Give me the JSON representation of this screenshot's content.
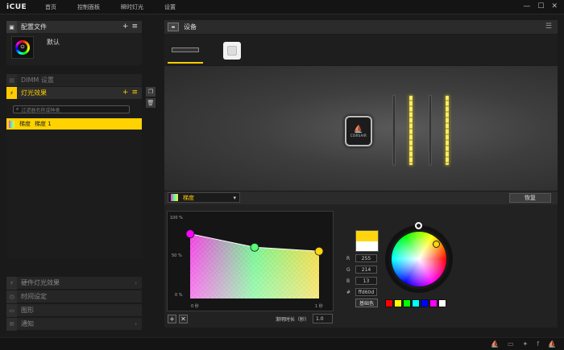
{
  "app": {
    "logo": "iCUE"
  },
  "nav": {
    "items": [
      "首页",
      "控制面板",
      "瞬时灯光",
      "设置"
    ]
  },
  "window": {
    "minimize": "—",
    "maximize": "☐",
    "close": "✕"
  },
  "profiles": {
    "title": "配置文件",
    "add": "+",
    "menu": "≡",
    "current": "默认"
  },
  "dimm": {
    "title": "DIMM 设置"
  },
  "lighting": {
    "title": "灯光效果",
    "add": "+",
    "menu": "≡",
    "filter_placeholder": "过滤器名称或种类",
    "effect_type": "梯度",
    "effect_name": "梯度 1"
  },
  "lower_nav": {
    "hardware": "硬件灯光效果",
    "time": "时间设定",
    "graphics": "图形",
    "notify": "通知"
  },
  "devices": {
    "title": "设备",
    "pump_brand": "CORSAIR"
  },
  "editor": {
    "effect_select": "梯度",
    "restore": "恢复",
    "y_labels": [
      "100 %",
      "50 %",
      "0 %"
    ],
    "x_start": "0 秒",
    "x_end": "1 秒",
    "add": "+",
    "remove": "✕",
    "duration_label": "渐明时长（秒）",
    "duration_value": "1.0"
  },
  "color": {
    "r_label": "R",
    "r": "255",
    "g_label": "G",
    "g": "214",
    "b_label": "B",
    "b": "13",
    "hex_label": "#",
    "hex": "ffd60d",
    "base_button": "基础色",
    "presets": [
      "#ff0000",
      "#ffff00",
      "#00ff00",
      "#00ffff",
      "#0000ff",
      "#ff00ff",
      "#ffffff"
    ]
  },
  "gradient_points": [
    {
      "time": 0.0,
      "brightness": 0.82,
      "color": "#ff00ff"
    },
    {
      "time": 0.5,
      "brightness": 0.65,
      "color": "#55ff77"
    },
    {
      "time": 1.0,
      "brightness": 0.6,
      "color": "#ffd60d"
    }
  ]
}
